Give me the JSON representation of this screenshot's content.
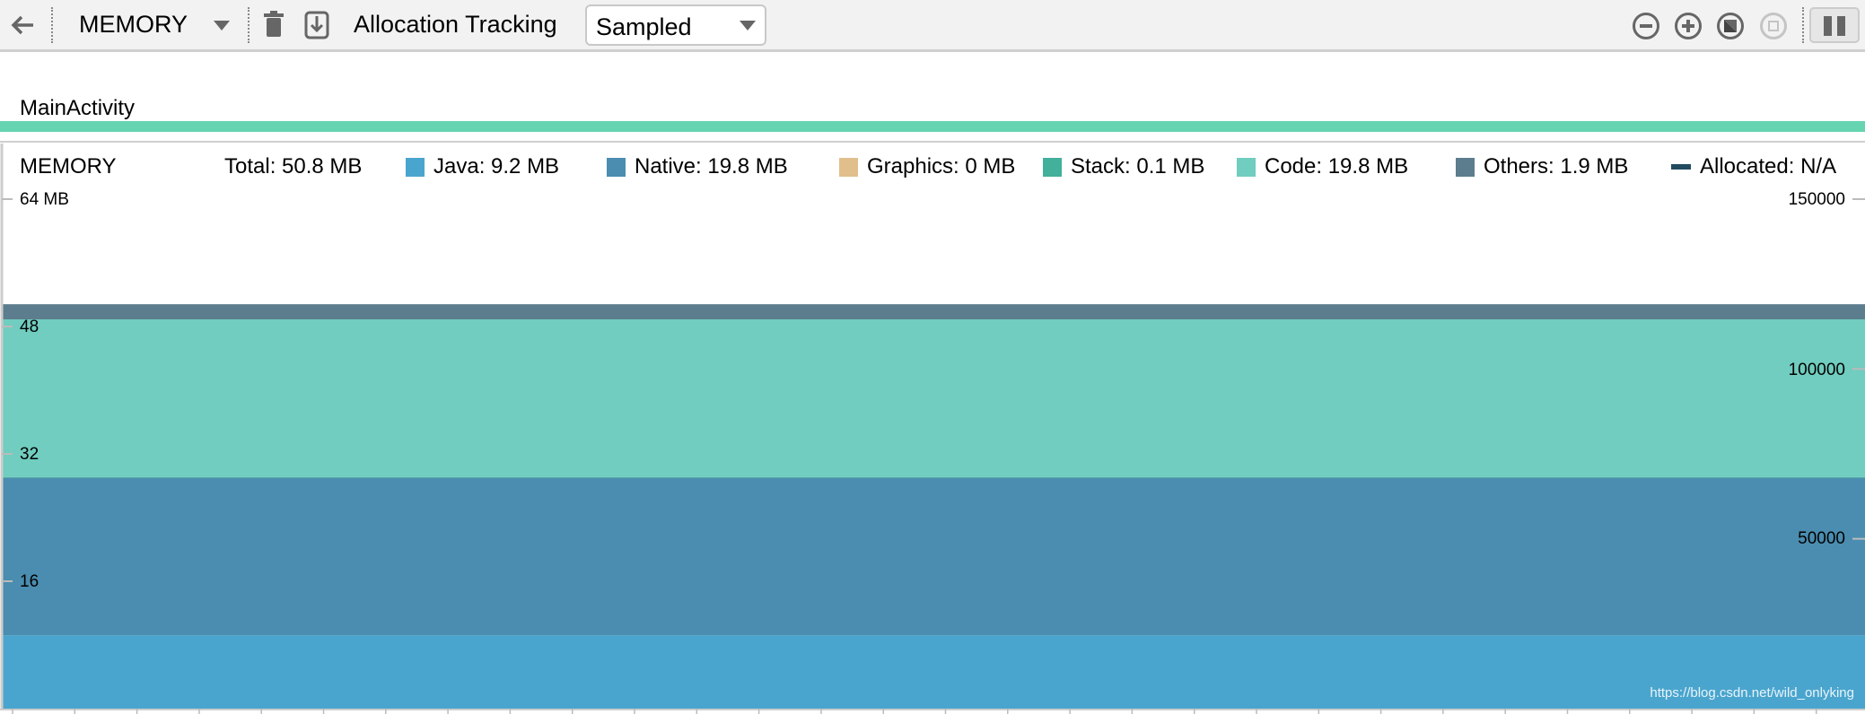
{
  "toolbar": {
    "back_icon": "arrow-left-icon",
    "profiler": "MEMORY",
    "gc_icon": "trash-icon",
    "dump_icon": "heap-dump-icon",
    "allocation_label": "Allocation Tracking",
    "allocation_value": "Sampled",
    "zoom_out_icon": "zoom-out-icon",
    "zoom_in_icon": "zoom-in-icon",
    "reset_zoom_icon": "reset-zoom-icon",
    "zoom_selection_icon": "zoom-to-selection-icon",
    "pause_icon": "pause-icon"
  },
  "lifecycle": {
    "activity": "MainActivity",
    "bar_color": "#66d4b0"
  },
  "legend": {
    "title": "MEMORY",
    "total": "Total: 50.8 MB",
    "items": [
      {
        "label": "Java: 9.2 MB",
        "color": "#4aa5ce"
      },
      {
        "label": "Native: 19.8 MB",
        "color": "#4a8db0"
      },
      {
        "label": "Graphics: 0 MB",
        "color": "#e1bf8c"
      },
      {
        "label": "Stack: 0.1 MB",
        "color": "#42b09a"
      },
      {
        "label": "Code: 19.8 MB",
        "color": "#70cdbf"
      },
      {
        "label": "Others: 1.9 MB",
        "color": "#5c7d8d"
      },
      {
        "label": "Allocated: N/A",
        "color": "#224b60"
      }
    ]
  },
  "chart_data": {
    "type": "area",
    "stacked": true,
    "left_axis": {
      "unit": "MB",
      "ticks": [
        "64 MB",
        "48",
        "32",
        "16"
      ],
      "tick_values": [
        64,
        48,
        32,
        16
      ],
      "range": [
        0,
        64
      ]
    },
    "right_axis": {
      "ticks": [
        "150000",
        "100000",
        "50000"
      ],
      "tick_values": [
        150000,
        100000,
        50000
      ],
      "range": [
        0,
        150000
      ]
    },
    "series": [
      {
        "name": "Java",
        "value": 9.2,
        "color": "#4aa5ce"
      },
      {
        "name": "Native",
        "value": 19.8,
        "color": "#4a8db0"
      },
      {
        "name": "Graphics",
        "value": 0,
        "color": "#e1bf8c"
      },
      {
        "name": "Stack",
        "value": 0.1,
        "color": "#42b09a"
      },
      {
        "name": "Code",
        "value": 19.8,
        "color": "#70cdbf"
      },
      {
        "name": "Others",
        "value": 1.9,
        "color": "#5c7d8d"
      }
    ]
  },
  "watermark": "https://blog.csdn.net/wild_onlyking"
}
